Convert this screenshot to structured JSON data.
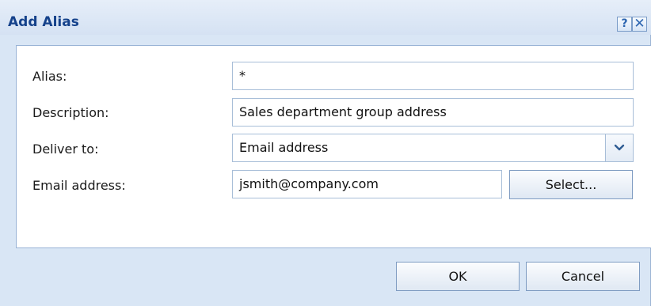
{
  "dialog": {
    "title": "Add Alias",
    "help_label": "?",
    "close_label": "✕"
  },
  "form": {
    "alias_label": "Alias:",
    "alias_value": "*",
    "description_label": "Description:",
    "description_value": "Sales department group address",
    "deliver_label": "Deliver to:",
    "deliver_value": "Email address",
    "email_label": "Email address:",
    "email_value": "jsmith@company.com",
    "select_label": "Select..."
  },
  "footer": {
    "ok_label": "OK",
    "cancel_label": "Cancel"
  },
  "icons": {
    "help": "help-icon",
    "close": "close-icon",
    "dropdown": "chevron-down-icon"
  }
}
